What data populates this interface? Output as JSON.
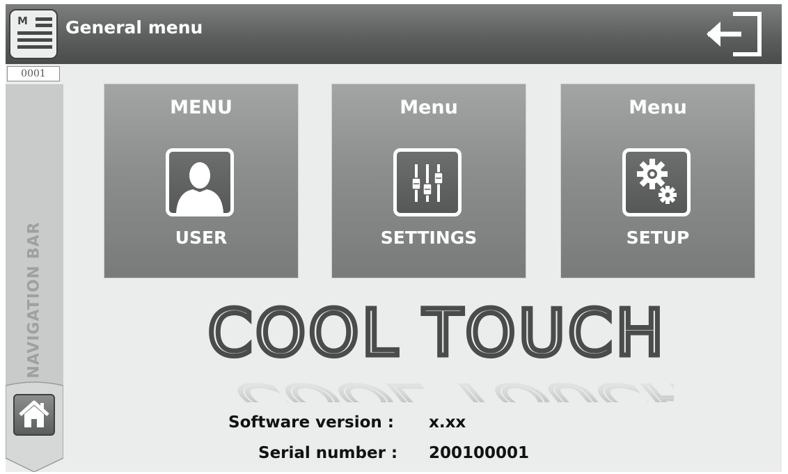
{
  "header": {
    "menu_icon_text": "M",
    "title": "General menu",
    "menu_icon": "menu-list-icon",
    "exit_icon": "exit-icon"
  },
  "sidebar": {
    "counter": "0001",
    "nav_label": "NAVIGATION BAR",
    "home_icon": "home-icon"
  },
  "tiles": [
    {
      "title": "MENU",
      "label": "USER",
      "icon": "user-icon"
    },
    {
      "title": "Menu",
      "label": "SETTINGS",
      "icon": "sliders-icon"
    },
    {
      "title": "Menu",
      "label": "SETUP",
      "icon": "gears-icon"
    }
  ],
  "logo": {
    "text": "COOL TOUCH"
  },
  "info": {
    "software_label": "Software version :",
    "software_value": "x.xx",
    "serial_label": "Serial number :",
    "serial_value": "200100001"
  },
  "colors": {
    "header_bg": "#5d5f5e",
    "tile_bg": "#8c8e8d",
    "screen_bg": "#eaedeb",
    "nav_bar_bg": "#c9cbca"
  }
}
